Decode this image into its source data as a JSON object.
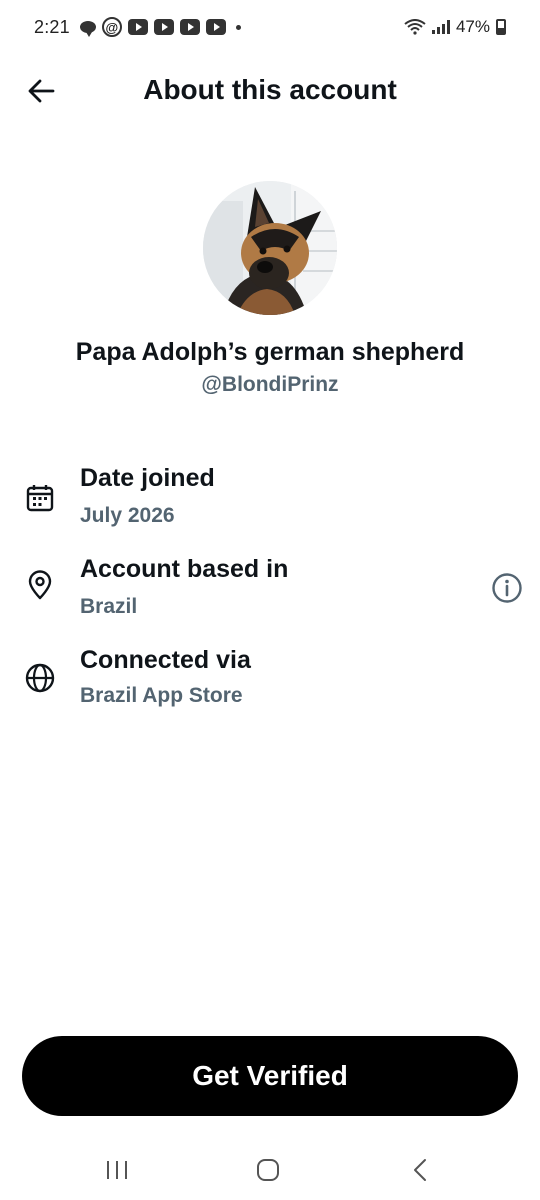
{
  "status_bar": {
    "time": "2:21",
    "battery": "47%"
  },
  "header": {
    "title": "About this account"
  },
  "profile": {
    "display_name": "Papa Adolph’s german shepherd",
    "handle": "@BlondiPrinz"
  },
  "info": [
    {
      "icon": "calendar-icon",
      "title": "Date joined",
      "value": "July 2026"
    },
    {
      "icon": "location-pin-icon",
      "title": "Account based in",
      "value": "Brazil"
    },
    {
      "icon": "globe-icon",
      "title": "Connected via",
      "value": "Brazil App Store"
    }
  ],
  "actions": {
    "verify_label": "Get Verified"
  },
  "colors": {
    "text_primary": "#0f1419",
    "text_secondary": "#536471",
    "button_bg": "#000000",
    "button_text": "#ffffff"
  }
}
